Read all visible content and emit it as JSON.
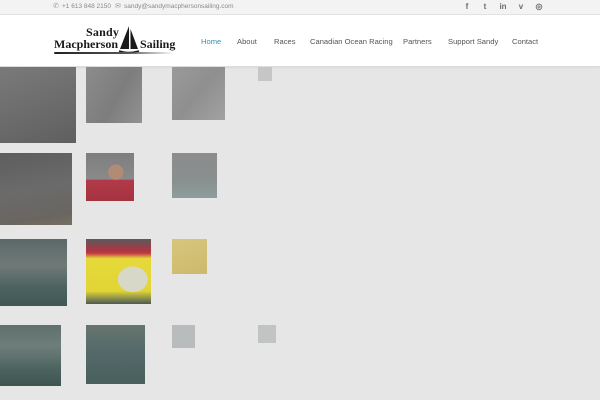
{
  "topbar": {
    "phone": "+1 613 848 2150",
    "email": "sandy@sandymacphersonsailing.com",
    "social": [
      {
        "icon": "facebook-icon",
        "glyph": "f"
      },
      {
        "icon": "twitter-icon",
        "glyph": "t"
      },
      {
        "icon": "linkedin-icon",
        "glyph": "in"
      },
      {
        "icon": "vimeo-icon",
        "glyph": "v"
      },
      {
        "icon": "instagram-icon",
        "glyph": "◎"
      }
    ]
  },
  "logo": {
    "line1": "Sandy",
    "line2": "Macpherson",
    "line3": "Sailing"
  },
  "nav": {
    "items": [
      {
        "label": "Home",
        "active": true
      },
      {
        "label": "About",
        "active": false
      },
      {
        "label": "Races",
        "active": false
      },
      {
        "label": "Canadian Ocean Racing",
        "active": false
      },
      {
        "label": "Partners",
        "active": false
      },
      {
        "label": "Support Sandy",
        "active": false
      },
      {
        "label": "Contact",
        "active": false
      }
    ]
  },
  "colors": {
    "accent": "#2a95c9",
    "background": "#e6e6e6",
    "topbar": "#f3f3f3"
  }
}
